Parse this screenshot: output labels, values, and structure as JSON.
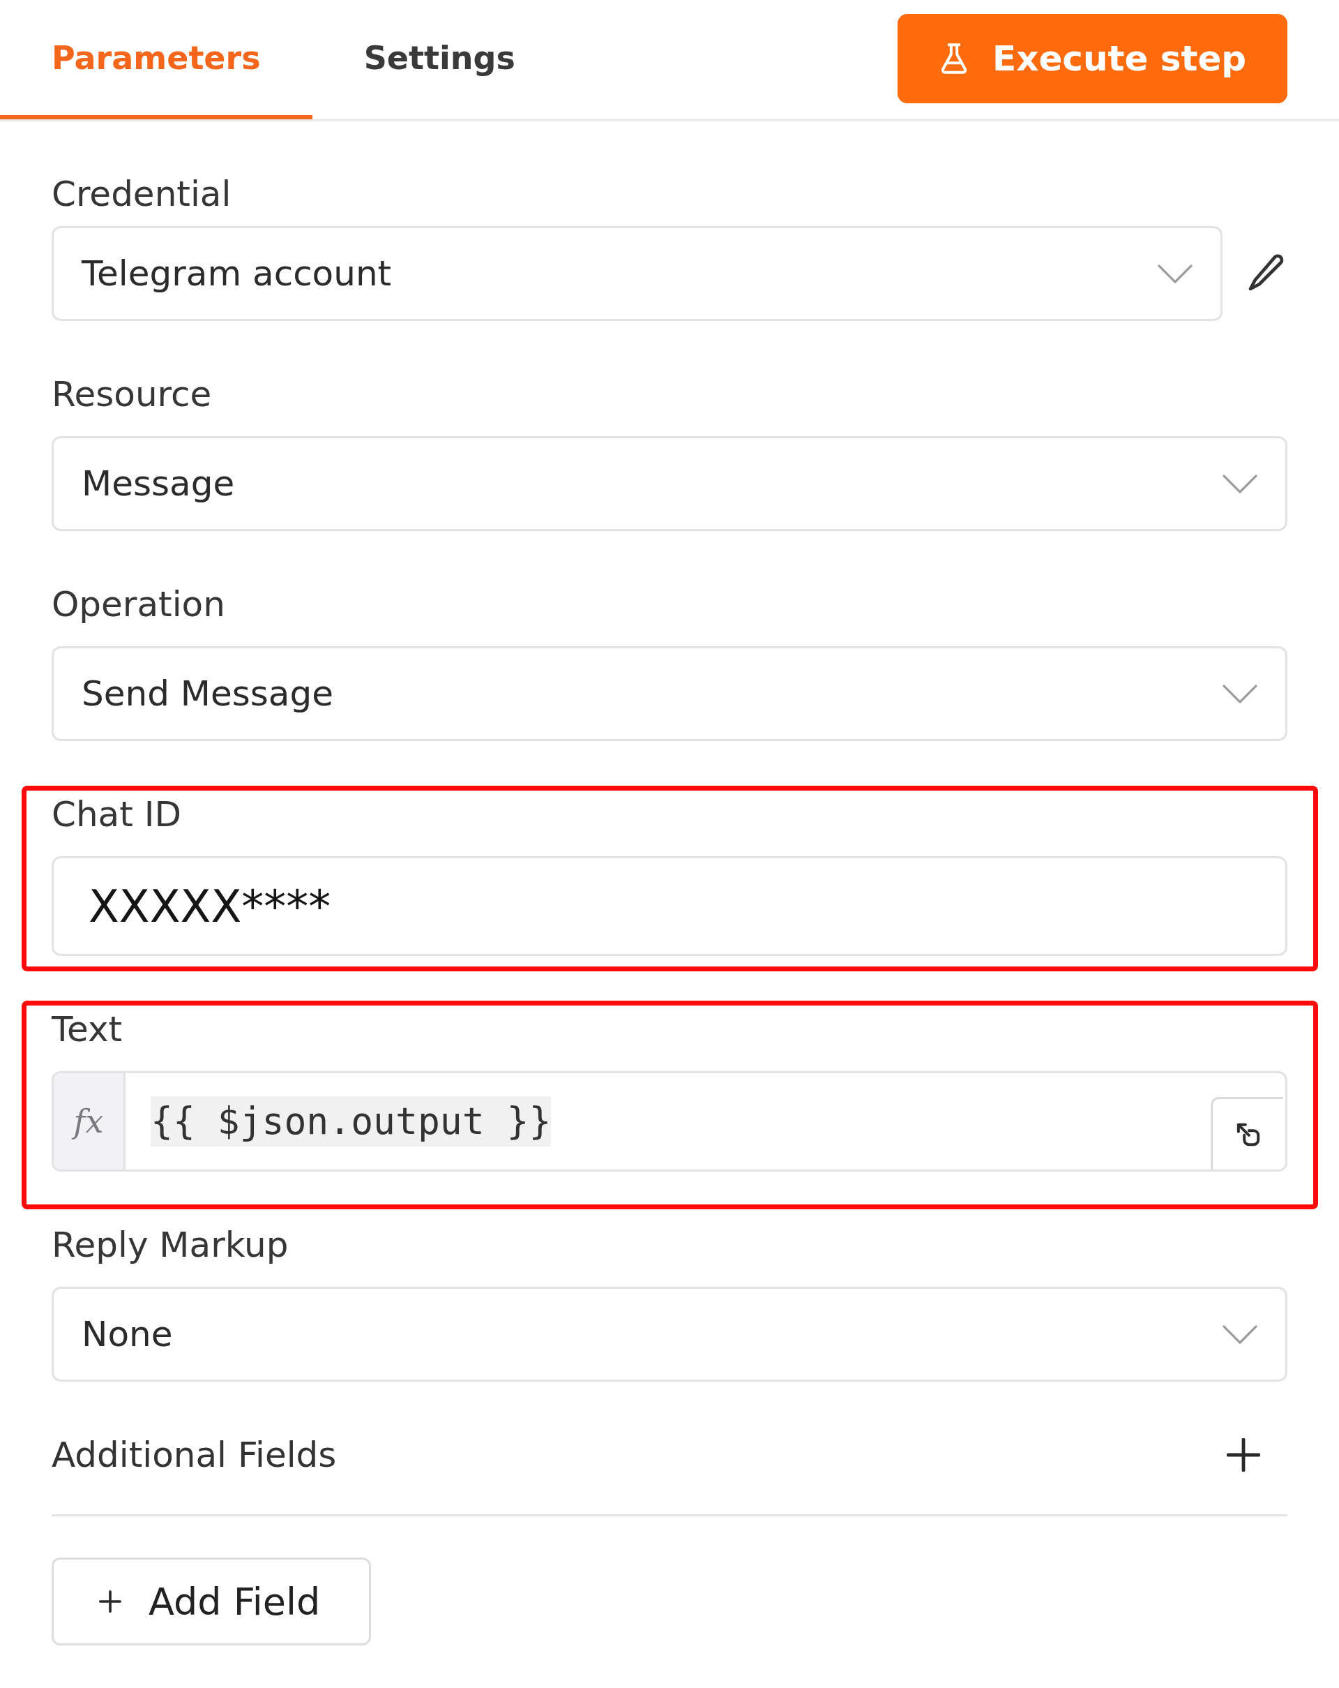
{
  "tabs": [
    {
      "label": "Parameters",
      "selected": true
    },
    {
      "label": "Settings",
      "selected": false
    }
  ],
  "execute_button": {
    "label": "Execute step"
  },
  "fields": [
    {
      "kind": "select",
      "label": "Credential",
      "value": "Telegram account",
      "editable": true,
      "highlighted": false
    },
    {
      "kind": "select",
      "label": "Resource",
      "value": "Message",
      "editable": false,
      "highlighted": false
    },
    {
      "kind": "select",
      "label": "Operation",
      "value": "Send Message",
      "editable": false,
      "highlighted": false
    },
    {
      "kind": "text",
      "label": "Chat ID",
      "value": "XXXXX****",
      "editable": false,
      "highlighted": true
    },
    {
      "kind": "expression",
      "label": "Text",
      "prefix": "fx",
      "value": "{{ $json.output }}",
      "editable": false,
      "highlighted": true
    },
    {
      "kind": "select",
      "label": "Reply Markup",
      "value": "None",
      "editable": false,
      "highlighted": false
    }
  ],
  "additional_fields": {
    "label": "Additional Fields",
    "button": "Add Field"
  }
}
